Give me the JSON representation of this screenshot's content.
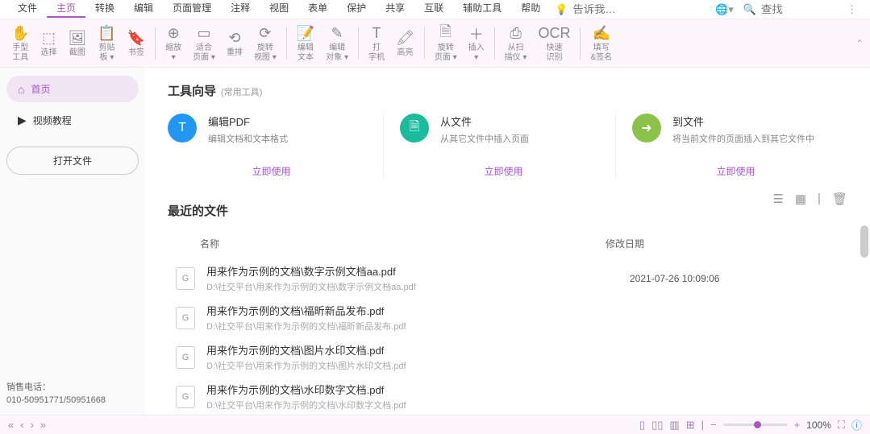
{
  "menu": {
    "items": [
      "文件",
      "主页",
      "转换",
      "编辑",
      "页面管理",
      "注释",
      "视图",
      "表单",
      "保护",
      "共享",
      "互联",
      "辅助工具",
      "帮助"
    ],
    "active": 1,
    "tell_placeholder": "告诉我…",
    "search_placeholder": "查找"
  },
  "ribbon": [
    {
      "icon": "✋",
      "label": "手型\n工具"
    },
    {
      "icon": "⬚",
      "label": "选择"
    },
    {
      "icon": "🖼",
      "label": "截图"
    },
    {
      "icon": "📋",
      "label": "剪贴\n板 ▾"
    },
    {
      "icon": "🔖",
      "label": "书签"
    },
    {
      "sep": true
    },
    {
      "icon": "⊕",
      "label": "缩放\n▾"
    },
    {
      "icon": "▭",
      "label": "适合\n页面 ▾"
    },
    {
      "icon": "⟲",
      "label": "重排"
    },
    {
      "icon": "⟳",
      "label": "旋转\n视图 ▾"
    },
    {
      "sep": true
    },
    {
      "icon": "📝",
      "label": "编辑\n文本"
    },
    {
      "icon": "✎",
      "label": "编辑\n对象 ▾"
    },
    {
      "sep": true
    },
    {
      "icon": "T",
      "label": "打\n字机"
    },
    {
      "icon": "🖍",
      "label": "高亮"
    },
    {
      "sep": true
    },
    {
      "icon": "🗎",
      "label": "旋转\n页面 ▾"
    },
    {
      "icon": "＋",
      "label": "插入\n▾"
    },
    {
      "sep": true
    },
    {
      "icon": "⎙",
      "label": "从扫\n描仪 ▾"
    },
    {
      "icon": "OCR",
      "label": "快速\n识别"
    },
    {
      "sep": true
    },
    {
      "icon": "✍",
      "label": "填写\n&签名"
    }
  ],
  "sidebar": {
    "home": "首页",
    "video": "视频教程",
    "open": "打开文件",
    "phone_label": "销售电话：",
    "phone": "010-50951771/50951668"
  },
  "wizard": {
    "title": "工具向导",
    "sub": "(常用工具)",
    "use": "立即使用",
    "cards": [
      {
        "color": "blue",
        "icon": "T",
        "title": "编辑PDF",
        "desc": "编辑文档和文本格式"
      },
      {
        "color": "teal",
        "icon": "🗎",
        "title": "从文件",
        "desc": "从其它文件中插入页面"
      },
      {
        "color": "green",
        "icon": "➜",
        "title": "到文件",
        "desc": "将当前文件的页面插入到其它文件中"
      }
    ]
  },
  "recent": {
    "title": "最近的文件",
    "col_name": "名称",
    "col_date": "修改日期",
    "files": [
      {
        "name": "用来作为示例的文档\\数字示例文档aa.pdf",
        "path": "D:\\社交平台\\用来作为示例的文档\\数字示例文档aa.pdf",
        "date": "2021-07-26 10:09:06"
      },
      {
        "name": "用来作为示例的文档\\福昕新品发布.pdf",
        "path": "D:\\社交平台\\用来作为示例的文档\\福昕新品发布.pdf",
        "date": ""
      },
      {
        "name": "用来作为示例的文档\\图片水印文档.pdf",
        "path": "D:\\社交平台\\用来作为示例的文档\\图片水印文档.pdf",
        "date": ""
      },
      {
        "name": "用来作为示例的文档\\水印数字文档.pdf",
        "path": "D:\\社交平台\\用来作为示例的文档\\水印数字文档.pdf",
        "date": ""
      }
    ]
  },
  "status": {
    "zoom": "100%"
  }
}
